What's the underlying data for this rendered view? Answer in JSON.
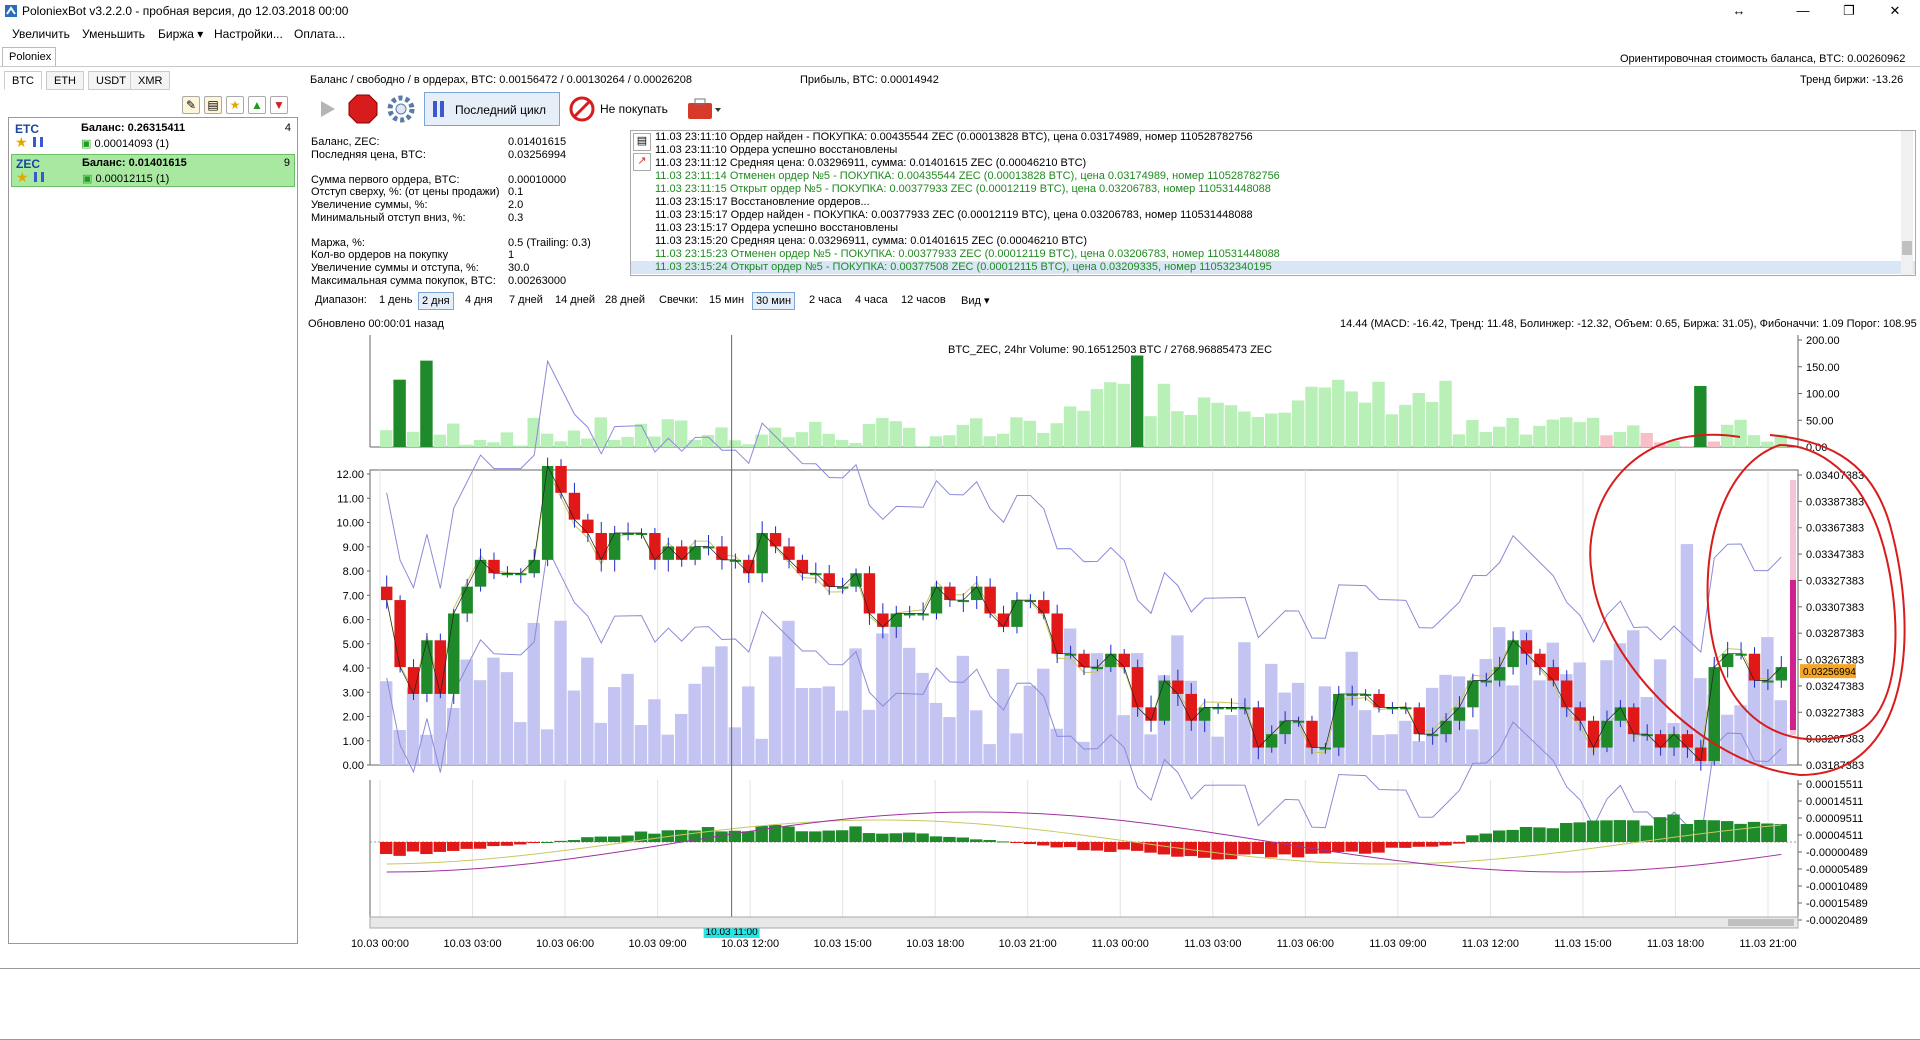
{
  "window": {
    "title": "PoloniexBot v3.2.2.0 - пробная версия, до 12.03.2018 00:00",
    "btn_restore": "↔",
    "btn_min": "—",
    "btn_max": "❐",
    "btn_close": "✕"
  },
  "menu": [
    "Увеличить",
    "Уменьшить",
    "Биржа ▾",
    "Настройки...",
    "Оплата..."
  ],
  "exchange_tab": "Poloniex",
  "estimated_balance": "Ориентировочная стоимость баланса, BTC: 0.00260962",
  "balance_line": "Баланс / свободно / в ордерах, BTC: 0.00156472 / 0.00130264 / 0.00026208",
  "profit": "Прибыль, BTC: 0.00014942",
  "exchange_trend": "Тренд биржи: -13.26",
  "coin_tabs": [
    "BTC",
    "ETH",
    "USDT",
    "XMR"
  ],
  "coins": [
    {
      "name": "ETC",
      "balance": "Баланс: 0.26315411",
      "sub": "0.00014093 (1)",
      "count": "4"
    },
    {
      "name": "ZEC",
      "balance": "Баланс: 0.01401615",
      "sub": "0.00012115 (1)",
      "count": "9"
    }
  ],
  "toolbar": {
    "last_cycle": "Последний цикл",
    "dont_buy": "Не покупать"
  },
  "info_labels": [
    "Баланс, ZEC:",
    "Последняя цена, BTC:",
    "",
    "Сумма первого ордера, BTC:",
    "Отступ сверху, %: (от цены продажи)",
    "Увеличение суммы, %:",
    "Минимальный отступ вниз, %:",
    "",
    "Маржа, %:",
    "Кол-во ордеров на покупку",
    "Увеличение суммы и отступа, %:",
    "Максимальная сумма покупок, BTC:"
  ],
  "info_values": [
    "0.01401615",
    "0.03256994",
    "",
    "0.00010000",
    "0.1",
    "2.0",
    "0.3",
    "",
    "0.5 (Trailing: 0.3)",
    "1",
    "30.0",
    "0.00263000"
  ],
  "log": [
    {
      "t": "11.03 23:11:10  Ордер найден - ПОКУПКА: 0.00435544 ZEC (0.00013828 BTC), цена 0.03174989, номер 110528782756",
      "c": ""
    },
    {
      "t": "11.03 23:11:10  Ордера успешно восстановлены",
      "c": ""
    },
    {
      "t": "11.03 23:11:12  Средняя цена: 0.03296911, сумма: 0.01401615 ZEC (0.00046210 BTC)",
      "c": ""
    },
    {
      "t": "11.03 23:11:14  Отменен ордер №5 - ПОКУПКА: 0.00435544 ZEC (0.00013828 BTC), цена 0.03174989, номер 110528782756",
      "c": "gr"
    },
    {
      "t": "11.03 23:11:15  Открыт ордер №5 - ПОКУПКА: 0.00377933 ZEC (0.00012119 BTC), цена 0.03206783, номер 110531448088",
      "c": "gr"
    },
    {
      "t": "11.03 23:15:17  Восстановление ордеров...",
      "c": ""
    },
    {
      "t": "11.03 23:15:17  Ордер найден - ПОКУПКА: 0.00377933 ZEC (0.00012119 BTC), цена 0.03206783, номер 110531448088",
      "c": ""
    },
    {
      "t": "11.03 23:15:17  Ордера успешно восстановлены",
      "c": ""
    },
    {
      "t": "11.03 23:15:20  Средняя цена: 0.03296911, сумма: 0.01401615 ZEC (0.00046210 BTC)",
      "c": ""
    },
    {
      "t": "11.03 23:15:23  Отменен ордер №5 - ПОКУПКА: 0.00377933 ZEC (0.00012119 BTC), цена 0.03206783, номер 110531448088",
      "c": "gr"
    },
    {
      "t": "11.03 23:15:24  Открыт ордер №5 - ПОКУПКА: 0.00377508 ZEC (0.00012115 BTC), цена 0.03209335, номер 110532340195",
      "c": "gr sel"
    }
  ],
  "range_label": "Диапазон:",
  "ranges": [
    "1 день",
    "2 дня",
    "4 дня",
    "7 дней",
    "14 дней",
    "28 дней"
  ],
  "candles_label": "Свечки:",
  "candles": [
    "15 мин",
    "30 мин",
    "2 часа",
    "4 часа",
    "12 часов"
  ],
  "view_label": "Вид ▾",
  "updated": "Обновлено 00:00:01 назад",
  "indicators": "14.44 (MACD: -16.42, Тренд: 11.48, Болинжер: -12.32, Объем: 0.65, Биржа: 31.05), Фибоначчи: 1.09 Порог: 108.95",
  "chart_data": {
    "type": "candlestick",
    "title": "BTC_ZEC, 24hr Volume: 90.16512503 BTC / 2768.96885473 ZEC",
    "score_axis": [
      "200.00",
      "150.00",
      "100.00",
      "50.00",
      "0.00"
    ],
    "left_axis": [
      "12.00",
      "11.00",
      "10.00",
      "9.00",
      "8.00",
      "7.00",
      "6.00",
      "5.00",
      "4.00",
      "3.00",
      "2.00",
      "1.00",
      "0.00"
    ],
    "price_axis": [
      "0.03407383",
      "0.03387383",
      "0.03367383",
      "0.03347383",
      "0.03327383",
      "0.03307383",
      "0.03287383",
      "0.03267383",
      "0.03247383",
      "0.03227383",
      "0.03207383",
      "0.03187383"
    ],
    "macd_axis": [
      "0.00015511",
      "0.00014511",
      "0.00009511",
      "0.00004511",
      "-0.00000489",
      "-0.00005489",
      "-0.00010489",
      "-0.00015489",
      "-0.00020489"
    ],
    "x_labels": [
      "10.03 00:00",
      "10.03 03:00",
      "10.03 06:00",
      "10.03 09:00",
      "10.03 12:00",
      "10.03 15:00",
      "10.03 18:00",
      "10.03 21:00",
      "11.03 00:00",
      "11.03 03:00",
      "11.03 06:00",
      "11.03 09:00",
      "11.03 12:00",
      "11.03 15:00",
      "11.03 18:00",
      "11.03 21:00"
    ],
    "cursor_label": "10.03 11:00",
    "current_price": "0.03256994",
    "close_series": [
      0.0331,
      0.0326,
      0.0324,
      0.0328,
      0.0324,
      0.033,
      0.0332,
      0.0334,
      0.0333,
      0.0333,
      0.0333,
      0.0334,
      0.0341,
      0.0339,
      0.0337,
      0.0336,
      0.0334,
      0.0336,
      0.0336,
      0.0336,
      0.0334,
      0.0335,
      0.0334,
      0.0335,
      0.0335,
      0.0334,
      0.0334,
      0.0333,
      0.0336,
      0.0335,
      0.0334,
      0.0333,
      0.0333,
      0.0332,
      0.0332,
      0.0333,
      0.033,
      0.0329,
      0.033,
      0.033,
      0.033,
      0.0332,
      0.0331,
      0.0331,
      0.0332,
      0.033,
      0.0329,
      0.0331,
      0.0331,
      0.033,
      0.0327,
      0.0327,
      0.0326,
      0.0326,
      0.0327,
      0.0326,
      0.0323,
      0.0322,
      0.0325,
      0.0324,
      0.0322,
      0.0323,
      0.0323,
      0.0323,
      0.0323,
      0.032,
      0.0321,
      0.0322,
      0.0322,
      0.032,
      0.032,
      0.0324,
      0.0324,
      0.0324,
      0.0323,
      0.0323,
      0.0323,
      0.0321,
      0.0321,
      0.0322,
      0.0323,
      0.0325,
      0.0325,
      0.0326,
      0.0328,
      0.0327,
      0.0326,
      0.0325,
      0.0323,
      0.0322,
      0.032,
      0.0322,
      0.0323,
      0.0321,
      0.0321,
      0.032,
      0.0321,
      0.032,
      0.0319,
      0.0326,
      0.0327,
      0.0327,
      0.0325,
      0.0325,
      0.0326
    ]
  }
}
